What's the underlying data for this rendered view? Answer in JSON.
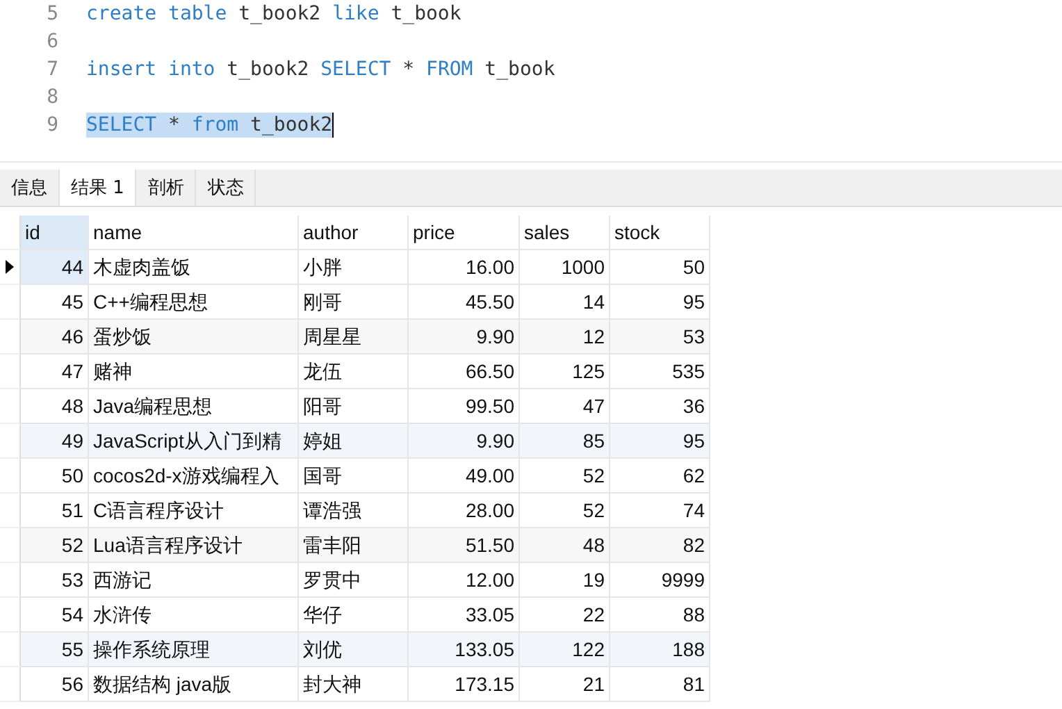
{
  "editor": {
    "lines": [
      {
        "number": "5",
        "selected": false,
        "tokens": [
          {
            "kind": "keyword",
            "text": "create"
          },
          {
            "kind": "keyword",
            "text": "table"
          },
          {
            "kind": "plain",
            "text": "t_book2"
          },
          {
            "kind": "keyword",
            "text": "like"
          },
          {
            "kind": "plain",
            "text": "t_book"
          }
        ]
      },
      {
        "number": "6",
        "selected": false
      },
      {
        "number": "7",
        "selected": false,
        "tokens": [
          {
            "kind": "keyword",
            "text": "insert"
          },
          {
            "kind": "keyword",
            "text": "into"
          },
          {
            "kind": "plain",
            "text": "t_book2"
          },
          {
            "kind": "keyword",
            "text": "SELECT"
          },
          {
            "kind": "plain",
            "text": "*"
          },
          {
            "kind": "keyword",
            "text": "FROM"
          },
          {
            "kind": "plain",
            "text": "t_book"
          }
        ]
      },
      {
        "number": "8",
        "selected": false
      },
      {
        "number": "9",
        "selected": true,
        "tokens": [
          {
            "kind": "keyword",
            "text": "SELECT"
          },
          {
            "kind": "plain",
            "text": "*"
          },
          {
            "kind": "keyword",
            "text": "from"
          },
          {
            "kind": "plain",
            "text": "t_book2"
          }
        ]
      }
    ]
  },
  "tabs": [
    {
      "label": "信息",
      "selected": false
    },
    {
      "label": "结果 1",
      "selected": true
    },
    {
      "label": "剖析",
      "selected": false
    },
    {
      "label": "状态",
      "selected": false
    }
  ],
  "table": {
    "columns": [
      "id",
      "name",
      "author",
      "price",
      "sales",
      "stock"
    ],
    "rows": [
      {
        "selected": true,
        "cells": [
          "44",
          "木虚肉盖饭",
          "小胖",
          "16.00",
          "1000",
          "50"
        ]
      },
      {
        "selected": false,
        "cells": [
          "45",
          "C++编程思想",
          "刚哥",
          "45.50",
          "14",
          "95"
        ]
      },
      {
        "selected": false,
        "cells": [
          "46",
          "蛋炒饭",
          "周星星",
          "9.90",
          "12",
          "53"
        ]
      },
      {
        "selected": false,
        "cells": [
          "47",
          "赌神",
          "龙伍",
          "66.50",
          "125",
          "535"
        ]
      },
      {
        "selected": false,
        "cells": [
          "48",
          "Java编程思想",
          "阳哥",
          "99.50",
          "47",
          "36"
        ]
      },
      {
        "selected": false,
        "cells": [
          "49",
          "JavaScript从入门到精",
          "婷姐",
          "9.90",
          "85",
          "95"
        ]
      },
      {
        "selected": false,
        "cells": [
          "50",
          "cocos2d-x游戏编程入",
          "国哥",
          "49.00",
          "52",
          "62"
        ]
      },
      {
        "selected": false,
        "cells": [
          "51",
          "C语言程序设计",
          "谭浩强",
          "28.00",
          "52",
          "74"
        ]
      },
      {
        "selected": false,
        "cells": [
          "52",
          "Lua语言程序设计",
          "雷丰阳",
          "51.50",
          "48",
          "82"
        ]
      },
      {
        "selected": false,
        "cells": [
          "53",
          "西游记",
          "罗贯中",
          "12.00",
          "19",
          "9999"
        ]
      },
      {
        "selected": false,
        "cells": [
          "54",
          "水浒传",
          "华仔",
          "33.05",
          "22",
          "88"
        ]
      },
      {
        "selected": false,
        "cells": [
          "55",
          "操作系统原理",
          "刘优",
          "133.05",
          "122",
          "188"
        ]
      },
      {
        "selected": false,
        "cells": [
          "56",
          "数据结构 java版",
          "封大神",
          "173.15",
          "21",
          "81"
        ]
      }
    ]
  }
}
